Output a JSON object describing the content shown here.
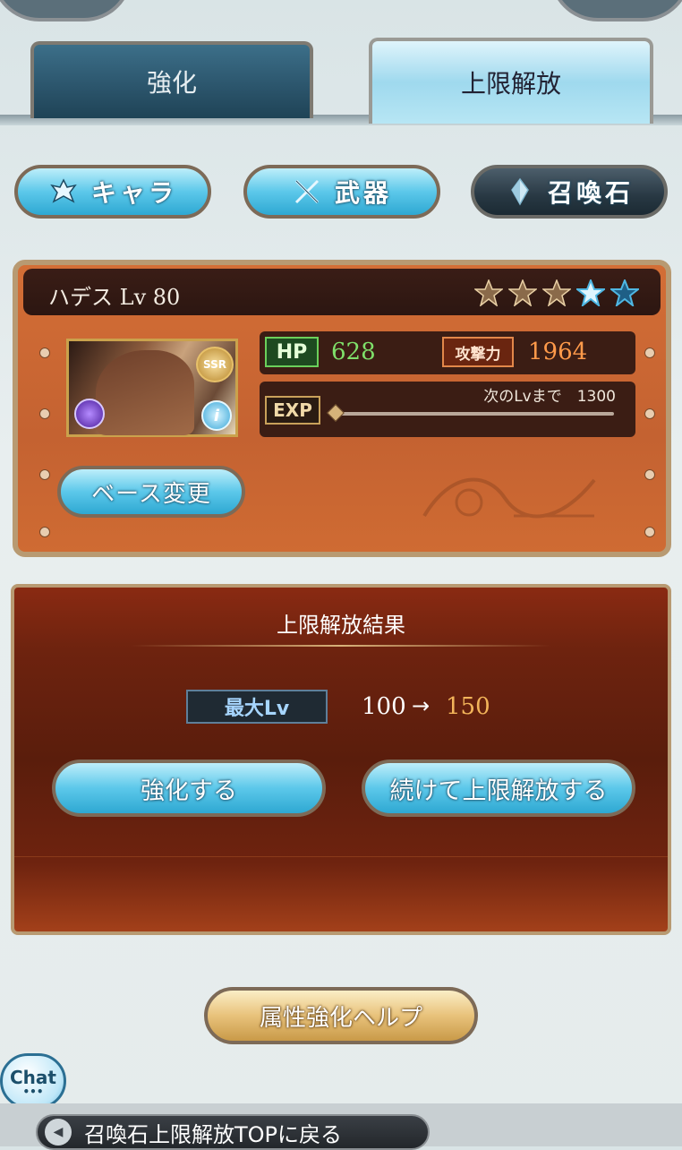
{
  "tabs": {
    "enhance": "強化",
    "limit_break": "上限解放"
  },
  "categories": {
    "chara": "キャラ",
    "weapon": "武器",
    "summon": "召喚石"
  },
  "summon": {
    "name": "ハデス Lv 80",
    "stars_filled": 3,
    "stars_total": 5,
    "rarity_badge": "SSR",
    "info_badge": "i",
    "hp_label": "HP",
    "hp_value": "628",
    "atk_label": "攻撃力",
    "atk_value": "1964",
    "exp_label": "EXP",
    "next_level_text": "次のLvまで　1300",
    "exp_progress": 0.0
  },
  "base_change_label": "ベース変更",
  "result": {
    "title": "上限解放結果",
    "max_lv_label": "最大Lv",
    "from": "100",
    "arrow": "→",
    "to": "150",
    "enhance_button": "強化する",
    "continue_button": "続けて上限解放する"
  },
  "help_button": "属性強化ヘルプ",
  "chat": {
    "label": "Chat",
    "dots": "•••"
  },
  "back": {
    "icon": "◀",
    "label": "召喚石上限解放TOPに戻る"
  },
  "colors": {
    "hp": "#7fe06a",
    "atk": "#ff9a4a",
    "lv_to": "#f2b45a"
  }
}
